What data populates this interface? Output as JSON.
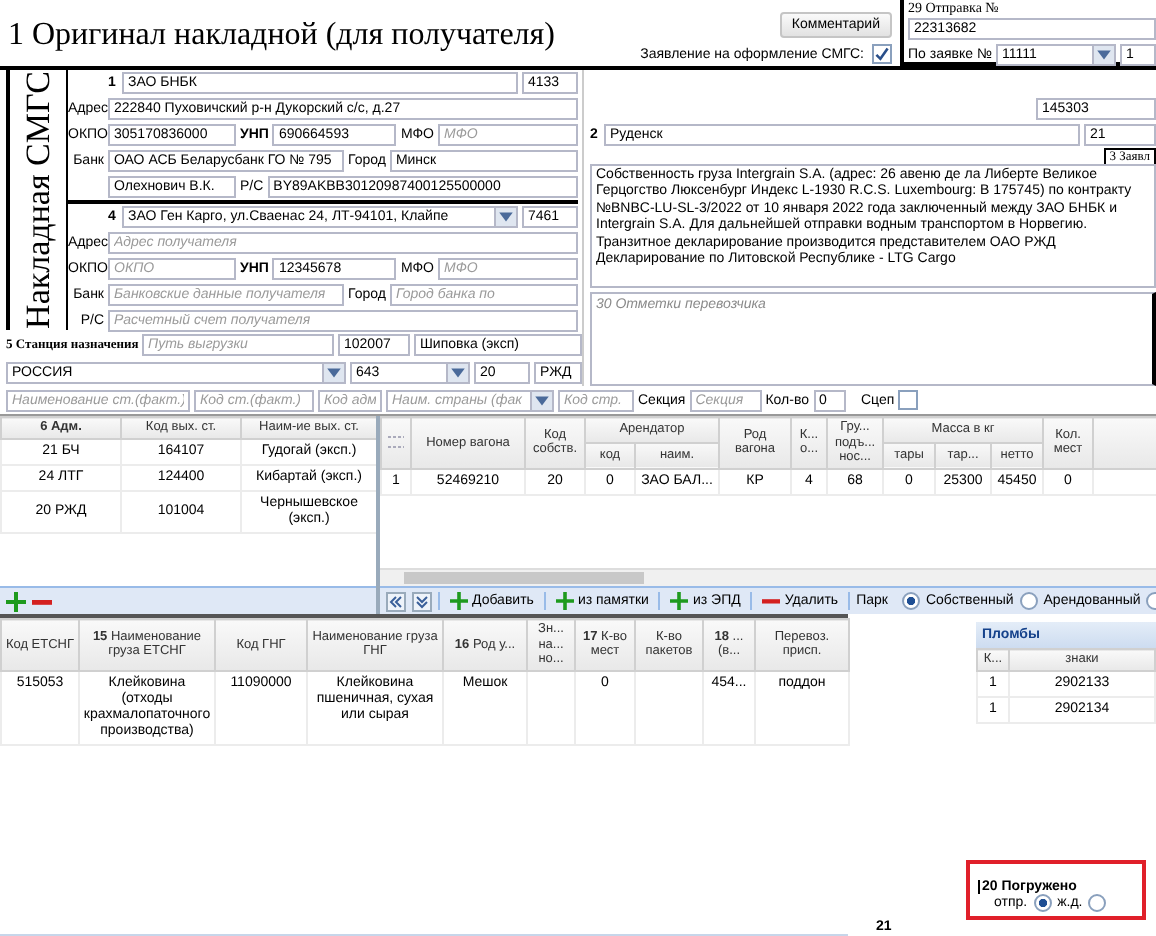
{
  "title": "1 Оригинал накладной (для получателя)",
  "comment_button": "Комментарий",
  "statement": {
    "label": "Заявление на оформление СМГС:",
    "checked": true
  },
  "shipment": {
    "label": "29 Отправка №",
    "number": "22313682",
    "request_label": "По заявке №",
    "request": "11111",
    "request_no": "1"
  },
  "side_title": "Накладная СМГС",
  "sender": {
    "number": "1",
    "name": "ЗАО БНБК",
    "code": "4133",
    "address_label": "Адрес",
    "address": "222840 Пуховичский р-н Дукорский с/с, д.27",
    "okpo_label": "ОКПО",
    "okpo": "305170836000",
    "unp_label": "УНП",
    "unp": "690664593",
    "mfo_label": "МФО",
    "mfo_placeholder": "МФО",
    "bank_label": "Банк",
    "bank": "ОАО АСБ Беларусбанк ГО № 795",
    "city_label": "Город",
    "city": "Минск",
    "signer": "Олехнович В.К.",
    "account_label": "Р/С",
    "account": "BY89AKBB30120987400125500000"
  },
  "receiver": {
    "number": "4",
    "name": "ЗАО Ген Карго, ул.Сваенас 24, ЛТ-94101, Клайпе",
    "code": "7461",
    "address_label": "Адрес",
    "address_placeholder": "Адрес получателя",
    "okpo_label": "ОКПО",
    "okpo_placeholder": "ОКПО",
    "unp_label": "УНП",
    "unp": "12345678",
    "mfo_label": "МФО",
    "mfo_placeholder": "МФО",
    "bank_label": "Банк",
    "bank_placeholder": "Банковские данные получателя",
    "city_label": "Город",
    "city_placeholder": "Город банка по",
    "account_label": "Р/С",
    "account_placeholder": "Расчетный счет получателя"
  },
  "departure": {
    "code": "145303",
    "number": "2",
    "station": "Руденск",
    "station_code": "21",
    "tab": "3 Заявл"
  },
  "remarks": "Собственность груза Intergrain S.A. (адрес: 26 авеню де ла Либерте Великое Герцогство Люксенбург Индекс L-1930 R.C.S. Luxembourg: B 175745) по контракту №BNBC-LU-SL-3/2022 от 10 января 2022 года заключенный между ЗАО БНБК и  Intergrain S.A. Для дальнейшей отправки водным транспортом в Норвегию. Транзитное декларирование производится представителем ОАО РЖД Декларирование по Литовской Республике - LTG Cargo",
  "carrier_marks_placeholder": "30 Отметки перевозчика",
  "destination": {
    "label": "5 Станция назначения",
    "route_placeholder": "Путь выгрузки",
    "station_code": "102007",
    "station": "Шиповка (эксп)",
    "country": "РОССИЯ",
    "country_code": "643",
    "railway_code": "20",
    "railway": "РЖД",
    "actual_station_placeholder": "Наименование ст.(факт.)",
    "actual_code_placeholder": "Код ст.(факт.)",
    "adm_code_placeholder": "Код адм",
    "actual_country_placeholder": "Наим. страны (фак",
    "country_code_placeholder": "Код стр."
  },
  "section": {
    "label": "Секция",
    "placeholder": "Секция"
  },
  "count": {
    "label": "Кол-во",
    "value": "0"
  },
  "coupling": {
    "label": "Сцеп",
    "checked": false
  },
  "adm_table": {
    "columns": [
      "6 Адм.",
      "Код вых. ст.",
      "Наим-ие вых. ст."
    ],
    "rows": [
      [
        "21 БЧ",
        "164107",
        "Гудогай (эксп.)"
      ],
      [
        "24 ЛТГ",
        "124400",
        "Кибартай (эксп.)"
      ],
      [
        "20 РЖД",
        "101004",
        "Чернышевское (эксп.)"
      ]
    ]
  },
  "wagon_table": {
    "columns": [
      {
        "kind": "handle"
      },
      {
        "label": "Номер вагона"
      },
      {
        "label": "Код собств."
      },
      {
        "label": "Арендатор",
        "colspan": 2,
        "children": [
          "код",
          "наим."
        ]
      },
      {
        "label": "Род вагона"
      },
      {
        "label": "К... о..."
      },
      {
        "label": "Гру... подъ... нос..."
      },
      {
        "label": "Масса в кг",
        "colspan": 3,
        "children": [
          "тары",
          "тар...",
          "нетто"
        ]
      },
      {
        "label": "Кол. мест"
      }
    ],
    "rows": [
      [
        "1",
        "52469210",
        "20",
        "0",
        "ЗАО БАЛ...",
        "КР",
        "4",
        "68",
        "0",
        "25300",
        "45450",
        "0"
      ]
    ]
  },
  "wagon_toolbar": {
    "buttons": [
      {
        "kind": "add",
        "label": "Добавить"
      },
      {
        "kind": "add",
        "label": "из памятки"
      },
      {
        "kind": "add",
        "label": "из ЭПД"
      },
      {
        "kind": "remove",
        "label": "Удалить"
      }
    ],
    "park_label": "Парк",
    "park_options": [
      {
        "label": "Собственный",
        "selected": true
      },
      {
        "label": "Арендованный",
        "selected": false
      },
      {
        "selected": false
      }
    ]
  },
  "cargo_table": {
    "columns": [
      "Код ЕТСНГ",
      "**15** Наименование груза ЕТСНГ",
      "Код ГНГ",
      "Наименование груза ГНГ",
      "**16** Род у...",
      "Зн... на... но...",
      "**17** К-во мест",
      "К-во пакетов",
      "**18** ... (в...",
      "Перевоз. присп."
    ],
    "rows": [
      [
        "515053",
        "Клейковина (отходы крахмалопаточного производства)",
        "11090000",
        "Клейковина пшеничная, сухая или сырая",
        "Мешок",
        "",
        "0",
        "",
        "454...",
        "поддон"
      ]
    ]
  },
  "seals": {
    "title": "Пломбы",
    "columns": [
      "К...",
      "знаки"
    ],
    "rows": [
      [
        "1",
        "2902133"
      ],
      [
        "1",
        "2902134"
      ]
    ]
  },
  "loaded": {
    "label": "20 Погружено",
    "options": [
      {
        "label": "отпр.",
        "selected": true
      },
      {
        "label": "ж.д.",
        "selected": false
      }
    ]
  },
  "field_21": "21"
}
